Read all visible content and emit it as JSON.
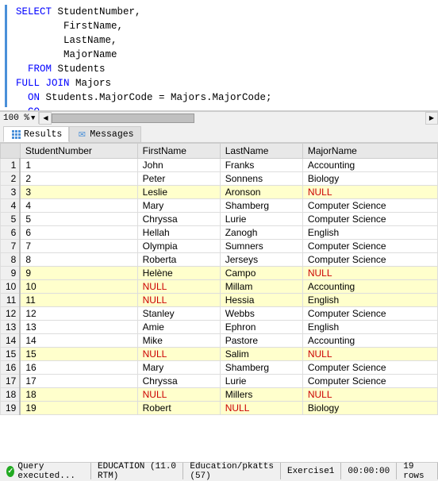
{
  "editor": {
    "lines": [
      {
        "tokens": [
          {
            "type": "keyword",
            "text": "SELECT"
          },
          {
            "type": "plain",
            "text": " StudentNumber,"
          }
        ]
      },
      {
        "tokens": [
          {
            "type": "plain",
            "text": "        FirstName,"
          }
        ]
      },
      {
        "tokens": [
          {
            "type": "plain",
            "text": "        LastName,"
          }
        ]
      },
      {
        "tokens": [
          {
            "type": "plain",
            "text": "        MajorName"
          }
        ]
      },
      {
        "tokens": [
          {
            "type": "keyword",
            "text": "  FROM"
          },
          {
            "type": "plain",
            "text": " Students"
          }
        ]
      },
      {
        "tokens": [
          {
            "type": "keyword",
            "text": "FULL "
          },
          {
            "type": "keyword",
            "text": "JOIN"
          },
          {
            "type": "plain",
            "text": " Majors"
          }
        ]
      },
      {
        "tokens": [
          {
            "type": "keyword",
            "text": "  ON"
          },
          {
            "type": "plain",
            "text": " Students.MajorCode = Majors.MajorCode;"
          }
        ]
      },
      {
        "tokens": [
          {
            "type": "keyword",
            "text": "  GO"
          }
        ]
      }
    ]
  },
  "zoom": "100 %",
  "tabs": [
    {
      "label": "Results",
      "icon": "grid",
      "active": true
    },
    {
      "label": "Messages",
      "icon": "message",
      "active": false
    }
  ],
  "table": {
    "columns": [
      "StudentNumber",
      "FirstName",
      "LastName",
      "MajorName"
    ],
    "rows": [
      {
        "num": "1",
        "cells": [
          "1",
          "John",
          "Franks",
          "Accounting"
        ],
        "null": false
      },
      {
        "num": "2",
        "cells": [
          "2",
          "Peter",
          "Sonnens",
          "Biology"
        ],
        "null": false
      },
      {
        "num": "3",
        "cells": [
          "3",
          "Leslie",
          "Aronson",
          "NULL"
        ],
        "null": true
      },
      {
        "num": "4",
        "cells": [
          "4",
          "Mary",
          "Shamberg",
          "Computer Science"
        ],
        "null": false
      },
      {
        "num": "5",
        "cells": [
          "5",
          "Chryssa",
          "Lurie",
          "Computer Science"
        ],
        "null": false
      },
      {
        "num": "6",
        "cells": [
          "6",
          "Hellah",
          "Zanogh",
          "English"
        ],
        "null": false
      },
      {
        "num": "7",
        "cells": [
          "7",
          "Olympia",
          "Sumners",
          "Computer Science"
        ],
        "null": false
      },
      {
        "num": "8",
        "cells": [
          "8",
          "Roberta",
          "Jerseys",
          "Computer Science"
        ],
        "null": false
      },
      {
        "num": "9",
        "cells": [
          "9",
          "Helène",
          "Campo",
          "NULL"
        ],
        "null": true
      },
      {
        "num": "10",
        "cells": [
          "10",
          "NULL",
          "Millam",
          "Accounting"
        ],
        "null": true
      },
      {
        "num": "11",
        "cells": [
          "11",
          "NULL",
          "Hessia",
          "English"
        ],
        "null": true
      },
      {
        "num": "12",
        "cells": [
          "12",
          "Stanley",
          "Webbs",
          "Computer Science"
        ],
        "null": false
      },
      {
        "num": "13",
        "cells": [
          "13",
          "Amie",
          "Ephron",
          "English"
        ],
        "null": false
      },
      {
        "num": "14",
        "cells": [
          "14",
          "Mike",
          "Pastore",
          "Accounting"
        ],
        "null": false
      },
      {
        "num": "15",
        "cells": [
          "15",
          "NULL",
          "Salim",
          "NULL"
        ],
        "null": true
      },
      {
        "num": "16",
        "cells": [
          "16",
          "Mary",
          "Shamberg",
          "Computer Science"
        ],
        "null": false
      },
      {
        "num": "17",
        "cells": [
          "17",
          "Chryssa",
          "Lurie",
          "Computer Science"
        ],
        "null": false
      },
      {
        "num": "18",
        "cells": [
          "18",
          "NULL",
          "Millers",
          "NULL"
        ],
        "null": true
      },
      {
        "num": "19",
        "cells": [
          "19",
          "Robert",
          "NULL",
          "Biology"
        ],
        "null": false
      }
    ]
  },
  "statusBar": {
    "message": "Query executed...",
    "server": "EDUCATION (11.0 RTM)",
    "db": "Education/pkatts (57)",
    "exercise": "Exercise1",
    "time": "00:00:00",
    "rows": "19 rows"
  }
}
